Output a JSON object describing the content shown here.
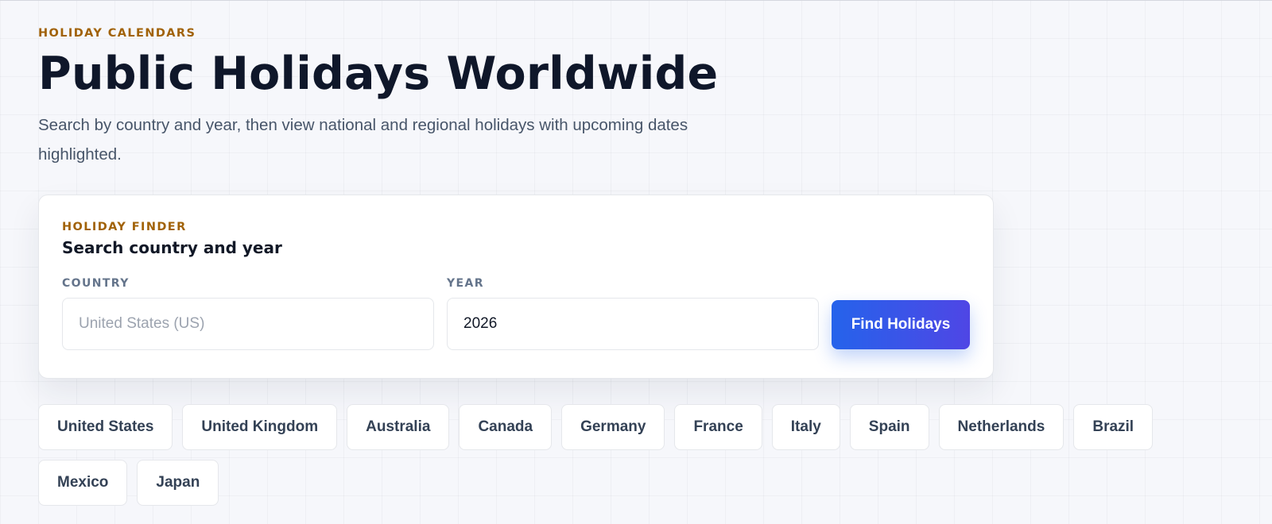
{
  "header": {
    "eyebrow": "HOLIDAY CALENDARS",
    "title": "Public Holidays Worldwide",
    "subtitle": "Search by country and year, then view national and regional holidays with upcoming dates highlighted."
  },
  "finder": {
    "eyebrow": "HOLIDAY FINDER",
    "title": "Search country and year",
    "country": {
      "label": "COUNTRY",
      "value": "",
      "placeholder": "United States (US)"
    },
    "year": {
      "label": "YEAR",
      "value": "2026",
      "placeholder": ""
    },
    "button_label": "Find Holidays"
  },
  "quick_countries": [
    "United States",
    "United Kingdom",
    "Australia",
    "Canada",
    "Germany",
    "France",
    "Italy",
    "Spain",
    "Netherlands",
    "Brazil",
    "Mexico",
    "Japan"
  ],
  "colors": {
    "accent": "#a16207",
    "primary": "#2563eb",
    "primary_end": "#4f46e5",
    "title": "#0f172a",
    "muted": "#475569"
  }
}
